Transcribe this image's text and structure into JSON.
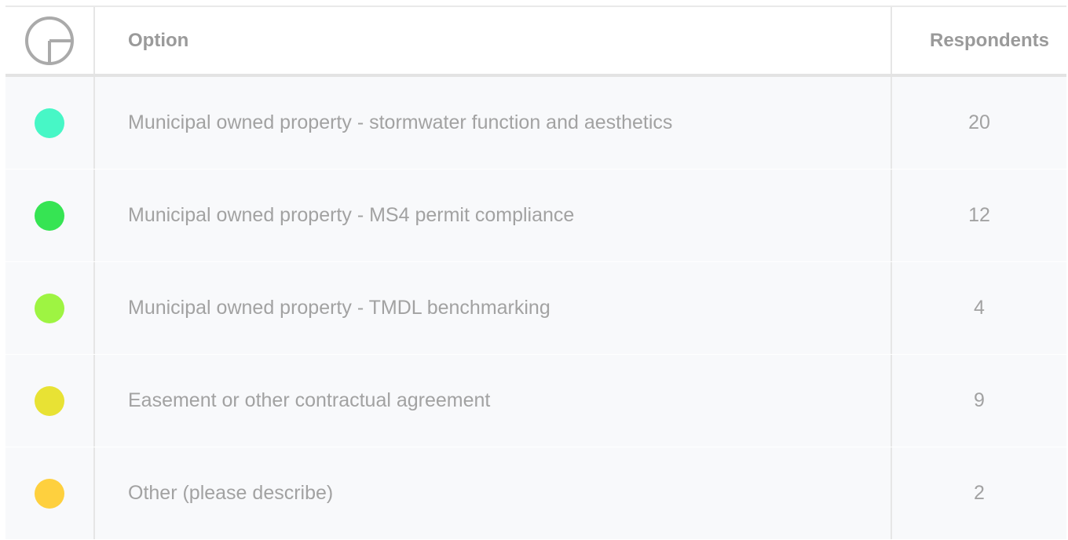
{
  "table": {
    "headers": {
      "logo_icon": "circle-logo-icon",
      "option": "Option",
      "respondents": "Respondents"
    },
    "rows": [
      {
        "color": "#47f7c6",
        "option": "Municipal owned property - stormwater function and aesthetics",
        "respondents": "20"
      },
      {
        "color": "#36e453",
        "option": "Municipal owned property - MS4 permit compliance",
        "respondents": "12"
      },
      {
        "color": "#9ef442",
        "option": "Municipal owned property - TMDL benchmarking",
        "respondents": "4"
      },
      {
        "color": "#e8e234",
        "option": "Easement or other contractual agreement",
        "respondents": "9"
      },
      {
        "color": "#fed03e",
        "option": "Other (please describe)",
        "respondents": "2"
      }
    ]
  }
}
